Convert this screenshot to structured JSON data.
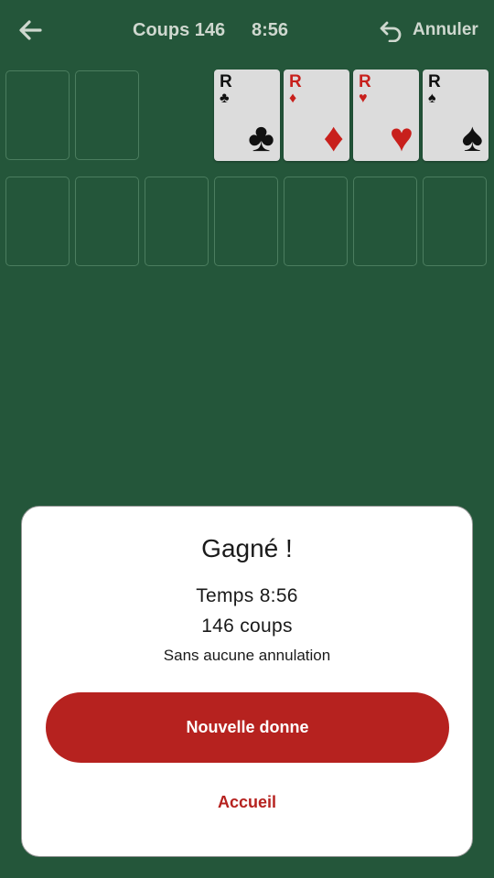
{
  "header": {
    "back_icon": "arrow-left-icon",
    "moves_label": "Coups 146",
    "timer": "8:56",
    "undo_icon": "undo-icon",
    "undo_label": "Annuler"
  },
  "freecells": [
    {
      "state": "empty"
    },
    {
      "state": "empty"
    }
  ],
  "foundations": [
    {
      "rank": "R",
      "suit": "♣",
      "color": "#111111"
    },
    {
      "rank": "R",
      "suit": "♦",
      "color": "#c8201c"
    },
    {
      "rank": "R",
      "suit": "♥",
      "color": "#c8201c"
    },
    {
      "rank": "R",
      "suit": "♠",
      "color": "#111111"
    }
  ],
  "tableau_columns": 7,
  "dialog": {
    "title": "Gagné !",
    "time": "Temps 8:56",
    "moves": "146 coups",
    "note": "Sans aucune annulation",
    "primary_button": "Nouvelle donne",
    "secondary_link": "Accueil"
  },
  "colors": {
    "felt": "#24563a",
    "slot_border": "#4b7d5f",
    "accent_red": "#b6221f",
    "card_face": "#dcdcdc"
  }
}
